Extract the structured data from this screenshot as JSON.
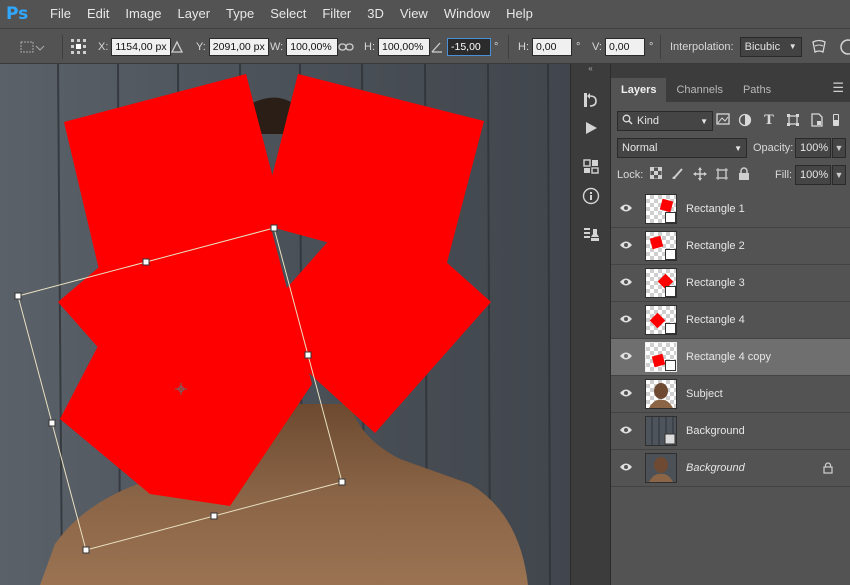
{
  "app": {
    "logo": "Ps"
  },
  "menu": [
    "File",
    "Edit",
    "Image",
    "Layer",
    "Type",
    "Select",
    "Filter",
    "3D",
    "View",
    "Window",
    "Help"
  ],
  "options": {
    "x_label": "X:",
    "x_value": "1154,00 px",
    "y_label": "Y:",
    "y_value": "2091,00 px",
    "w_label": "W:",
    "w_value": "100,00%",
    "h_label": "H:",
    "h_value": "100,00%",
    "angle_value": "-15,00",
    "hskew_label": "H:",
    "hskew_value": "0,00",
    "vskew_label": "V:",
    "vskew_value": "0,00",
    "degree": "°",
    "interpolation_label": "Interpolation:",
    "interpolation_value": "Bicubic"
  },
  "panel": {
    "tabs": [
      {
        "label": "Layers",
        "active": true
      },
      {
        "label": "Channels",
        "active": false
      },
      {
        "label": "Paths",
        "active": false
      }
    ],
    "kind_label": "Kind",
    "blend_mode": "Normal",
    "opacity_label": "Opacity:",
    "opacity_value": "100%",
    "lock_label": "Lock:",
    "fill_label": "Fill:",
    "fill_value": "100%"
  },
  "layers": [
    {
      "name": "Rectangle 1",
      "type": "shape",
      "selected": false
    },
    {
      "name": "Rectangle 2",
      "type": "shape",
      "selected": false
    },
    {
      "name": "Rectangle 3",
      "type": "shape",
      "selected": false
    },
    {
      "name": "Rectangle 4",
      "type": "shape",
      "selected": false
    },
    {
      "name": "Rectangle 4 copy",
      "type": "shape",
      "selected": true
    },
    {
      "name": "Subject",
      "type": "photo-subject",
      "selected": false
    },
    {
      "name": "Background",
      "type": "photo-smart",
      "selected": false
    },
    {
      "name": "Background",
      "type": "photo-locked",
      "selected": false,
      "italic": true,
      "locked": true
    }
  ],
  "colors": {
    "shape_fill": "#ff0000",
    "ui_background": "#535353",
    "panel_dark": "#3c3c3c",
    "selection": "#6f6f6f"
  }
}
